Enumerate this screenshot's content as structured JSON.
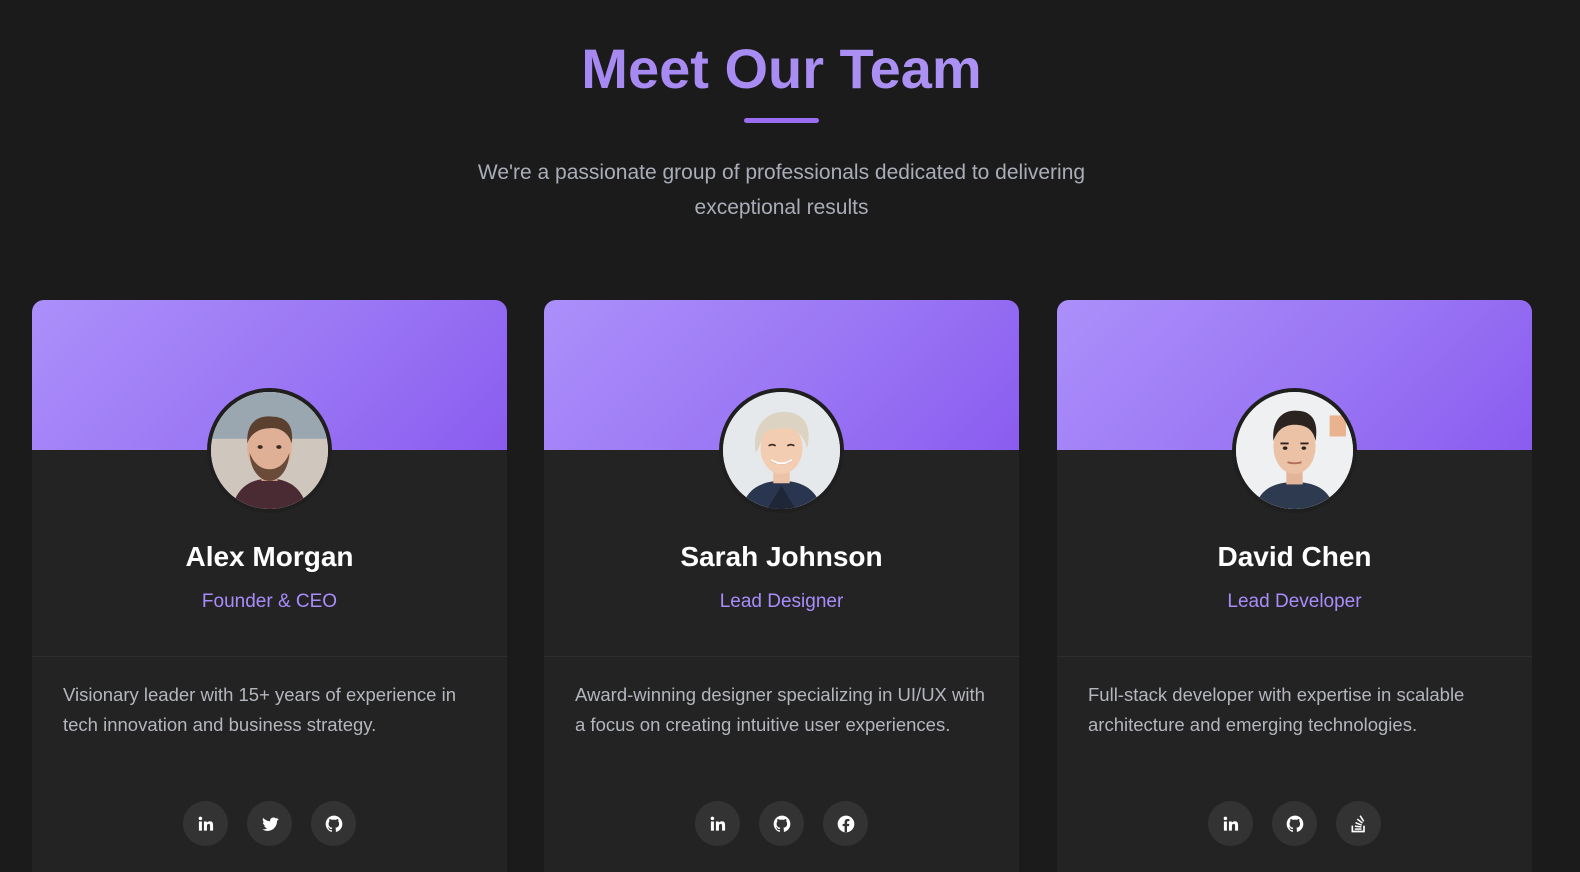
{
  "header": {
    "title": "Meet Our Team",
    "subtitle": "We're a passionate group of professionals dedicated to delivering exceptional results"
  },
  "colors": {
    "background": "#1b1b1b",
    "card": "#232323",
    "accent": "#9b6df3",
    "role_text": "#a98cfb"
  },
  "team": [
    {
      "name": "Alex Morgan",
      "role": "Founder & CEO",
      "bio": "Visionary leader with 15+ years of experience in tech innovation and business strategy.",
      "socials": [
        "linkedin-icon",
        "twitter-icon",
        "github-icon"
      ]
    },
    {
      "name": "Sarah Johnson",
      "role": "Lead Designer",
      "bio": "Award-winning designer specializing in UI/UX with a focus on creating intuitive user experiences.",
      "socials": [
        "linkedin-icon",
        "github-icon",
        "facebook-icon"
      ]
    },
    {
      "name": "David Chen",
      "role": "Lead Developer",
      "bio": "Full-stack developer with expertise in scalable architecture and emerging technologies.",
      "socials": [
        "linkedin-icon",
        "github-icon",
        "stack-overflow-icon"
      ]
    }
  ]
}
